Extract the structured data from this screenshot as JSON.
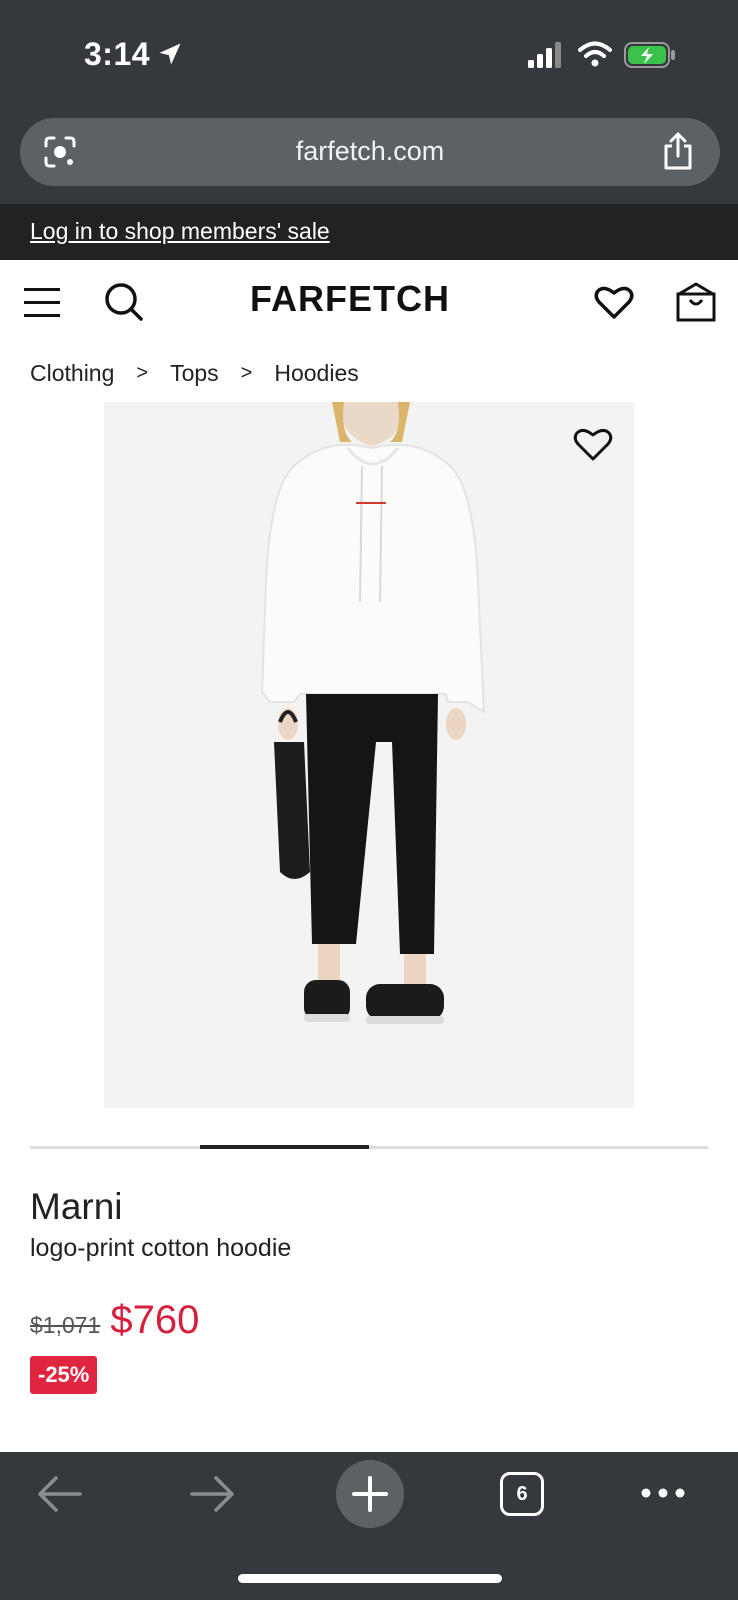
{
  "status_bar": {
    "time": "3:14"
  },
  "browser": {
    "url": "farfetch.com",
    "open_tabs": "6"
  },
  "promo": {
    "text": "Log in to shop members' sale"
  },
  "header": {
    "logo": "FARFETCH"
  },
  "breadcrumb": {
    "items": [
      "Clothing",
      "Tops",
      "Hoodies"
    ],
    "separator": ">"
  },
  "product": {
    "brand": "Marni",
    "name": "logo-print cotton hoodie",
    "original_price": "$1,071",
    "sale_price": "$760",
    "discount": "-25%"
  },
  "carousel": {
    "active_fraction_start": 0.25,
    "active_fraction_width": 0.25
  },
  "colors": {
    "chrome_bg": "#35383c",
    "urlbar_bg": "#5c6166",
    "sale_red": "#d61f3c",
    "discount_badge": "#e0253f",
    "battery_green": "#3ac34a"
  },
  "icons": [
    "location-arrow-icon",
    "signal-icon",
    "wifi-icon",
    "battery-charging-icon",
    "camera-lens-icon",
    "share-icon",
    "menu-icon",
    "search-icon",
    "heart-icon",
    "bag-icon",
    "back-arrow-icon",
    "forward-arrow-icon",
    "plus-icon",
    "more-icon"
  ]
}
